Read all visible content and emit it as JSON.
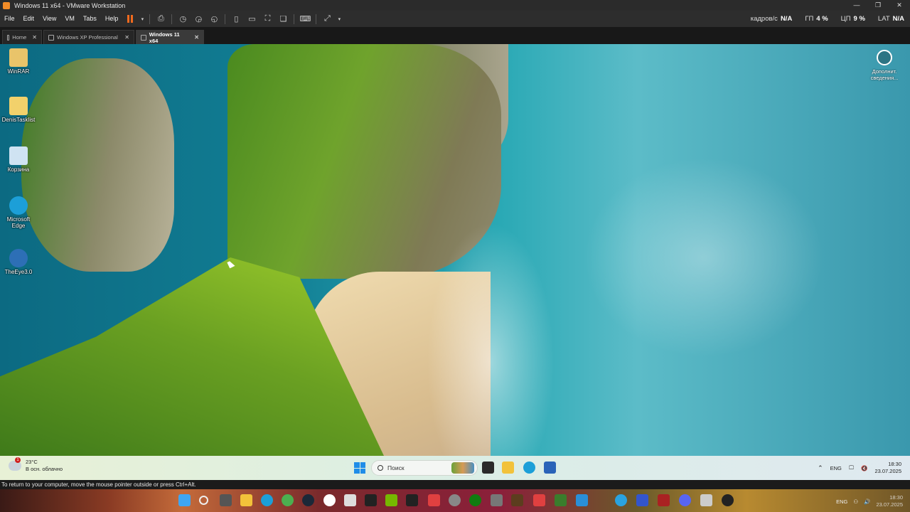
{
  "window": {
    "title": "Windows 11 x64 - VMware Workstation",
    "controls": [
      "minimize-icon",
      "restore-icon",
      "close-icon"
    ]
  },
  "menu": [
    "File",
    "Edit",
    "View",
    "VM",
    "Tabs",
    "Help"
  ],
  "stats": [
    {
      "label": "кадров/с",
      "value": "N/A"
    },
    {
      "label": "ГП",
      "value": "4 %"
    },
    {
      "label": "ЦП",
      "value": "9 %"
    },
    {
      "label": "LAT",
      "value": "N/A"
    }
  ],
  "tabs": [
    {
      "label": "Home",
      "active": false
    },
    {
      "label": "Windows XP Professional",
      "active": false
    },
    {
      "label": "Windows 11 x64",
      "active": true
    }
  ],
  "desktop": {
    "icons": [
      {
        "label": "WinRAR",
        "icon": "winrar-icon",
        "color": "#e9c46a"
      },
      {
        "label": "DenisTasklist",
        "icon": "folder-app-icon",
        "color": "#f2d16b"
      },
      {
        "label": "Корзина",
        "icon": "recycle-bin-icon",
        "color": "#cfe3f2"
      },
      {
        "label": "Microsoft Edge",
        "icon": "edge-icon",
        "color": "#1c9fd8"
      },
      {
        "label": "TheEye3.0",
        "icon": "eye-app-icon",
        "color": "#2d6fb6"
      }
    ],
    "info_widget": {
      "label": "Дополнит. сведения...",
      "icon": "info-camera-icon"
    }
  },
  "guest_taskbar": {
    "weather": {
      "temp": "23°C",
      "condition": "В осн. облачно",
      "badge": "1"
    },
    "search_placeholder": "Поиск",
    "apps": [
      "windows-start-icon",
      "search-icon",
      "photos-widget-icon",
      "terminal-icon",
      "file-explorer-icon",
      "edge-icon",
      "store-icon"
    ],
    "tray": {
      "lang": "ENG",
      "time": "18:30",
      "date": "23.07.2025"
    }
  },
  "vm_status": "To return to your computer, move the mouse pointer outside or press Ctrl+Alt.",
  "host_taskbar": {
    "apps": [
      "windows-start-icon",
      "search-icon",
      "task-view-icon",
      "file-explorer-icon",
      "edge-icon",
      "chrome-icon",
      "steam-icon",
      "yandex-icon",
      "store-icon",
      "epic-games-icon",
      "nvidia-icon",
      "terminal-icon",
      "app-icon",
      "settings-icon",
      "xbox-icon",
      "vmware-icon",
      "minecraft-icon",
      "app-icon",
      "app-icon",
      "app-icon",
      "telegram-icon",
      "app-icon",
      "app-icon",
      "discord-icon",
      "app-icon",
      "app-icon"
    ],
    "tray": {
      "lang": "ENG",
      "time": "18:30",
      "date": "23.07.2025"
    }
  },
  "colors": {
    "vmware_accent": "#f06a1e",
    "sea": "#117d93",
    "cliff": "#5f8a2a",
    "sand": "#e3c79a"
  }
}
